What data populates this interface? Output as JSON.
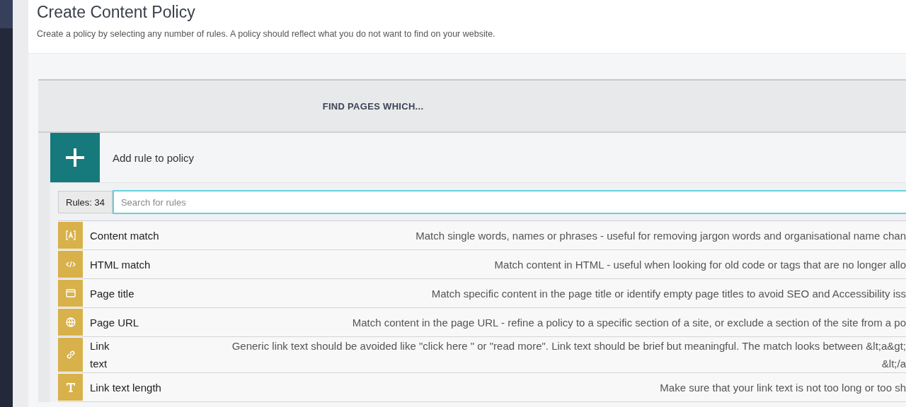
{
  "page": {
    "title": "Create Content Policy",
    "subtitle": "Create a policy by selecting any number of rules. A policy should reflect what you do not want to find on your website."
  },
  "policy": {
    "heading": "FIND PAGES WHICH...",
    "add_label": "Add rule to policy"
  },
  "rule_picker": {
    "count": "Rules: 34",
    "search": {
      "placeholder": "Search for rules"
    },
    "rules": [
      {
        "kind": "brackets",
        "name": "Content match",
        "description": [
          "Match single words, names or phrases - useful for removing jargon words and organisational name chan"
        ]
      },
      {
        "kind": "code",
        "name": "HTML match",
        "description": [
          "Match content in HTML - useful when looking for old code or tags that are no longer allo"
        ]
      },
      {
        "kind": "window",
        "name": "Page title",
        "description": [
          "Match specific content in the page title or identify empty page titles to avoid SEO and Accessibility iss"
        ]
      },
      {
        "kind": "globe",
        "name": "Page URL",
        "description": [
          "Match content in the page URL - refine a policy to a specific section of a site, or exclude a section of the site from a po"
        ]
      },
      {
        "kind": "link",
        "name": "Link text",
        "description": [
          "Generic link text should be avoided like \"click here \" or \"read more\". Link text should be brief but meaningful. The match looks between &lt;a&gt;",
          "&lt;/a"
        ]
      },
      {
        "kind": "letter",
        "name": "Link text length",
        "description": [
          "Make sure that your link text is not too long or too sh"
        ]
      }
    ]
  }
}
